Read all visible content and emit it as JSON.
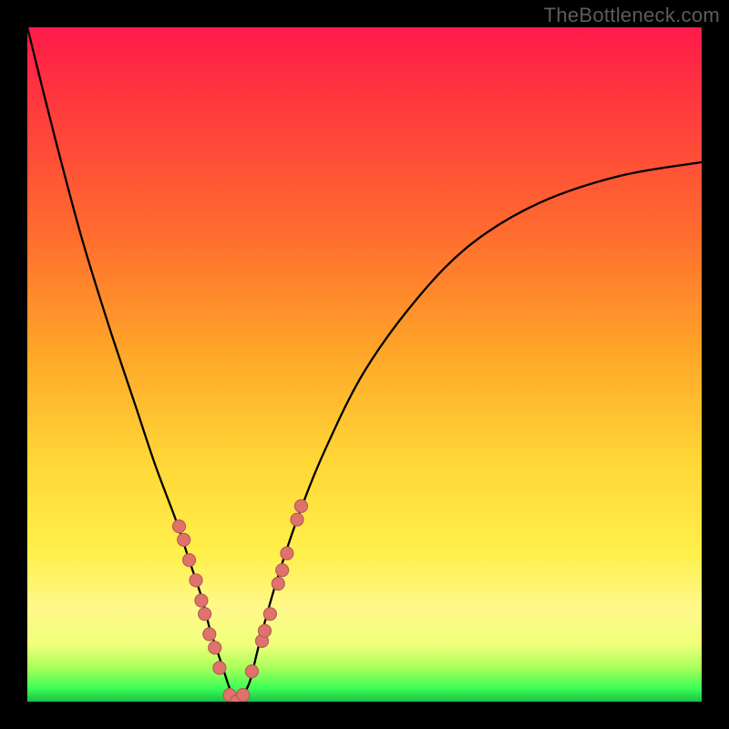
{
  "watermark": "TheBottleneck.com",
  "chart_data": {
    "type": "line",
    "title": "",
    "xlabel": "",
    "ylabel": "",
    "xlim": [
      0,
      100
    ],
    "ylim": [
      0,
      100
    ],
    "x": [
      0,
      4,
      8,
      12,
      16,
      19,
      22,
      24,
      26,
      27,
      28,
      29,
      30,
      31,
      32,
      33,
      34,
      35,
      37,
      40,
      44,
      50,
      58,
      66,
      76,
      88,
      100
    ],
    "values": [
      100,
      84,
      69,
      56,
      44,
      35,
      27,
      21,
      15,
      11,
      8,
      5,
      2,
      0,
      1,
      3,
      7,
      11,
      18,
      27,
      37,
      49,
      60,
      68,
      74,
      78,
      80
    ],
    "markers": {
      "x": [
        22.5,
        23.2,
        24.0,
        25.0,
        25.8,
        26.3,
        27.0,
        27.8,
        28.5,
        30.0,
        31.0,
        32.0,
        33.3,
        34.8,
        35.2,
        36.0,
        37.2,
        37.8,
        38.5,
        40.0,
        40.6
      ],
      "y": [
        26,
        24,
        21,
        18,
        15,
        13,
        10,
        8,
        5,
        1,
        0,
        1,
        4.5,
        9,
        10.5,
        13,
        17.5,
        19.5,
        22,
        27,
        29
      ],
      "color": "#e0726c",
      "radius": 7
    }
  }
}
